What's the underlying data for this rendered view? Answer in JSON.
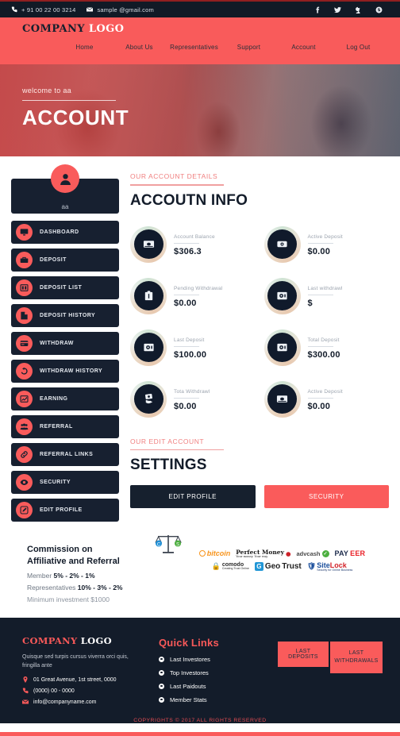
{
  "topbar": {
    "phone": "+ 91 00 22 00 3214",
    "email": "sample @gmail.com",
    "phone_icon": "phone-icon",
    "email_icon": "envelope-icon",
    "social": [
      {
        "name": "facebook-icon",
        "glyph": "f"
      },
      {
        "name": "twitter-icon",
        "glyph": "t"
      },
      {
        "name": "google-plus-icon",
        "glyph": "g"
      },
      {
        "name": "skype-icon",
        "glyph": "s"
      }
    ]
  },
  "nav": {
    "logo_part1": "COMPANY",
    "logo_part2": "LOGO",
    "items": [
      {
        "label": "Home"
      },
      {
        "label": "About Us"
      },
      {
        "label": "Representatives"
      },
      {
        "label": "Support"
      },
      {
        "label": "Account"
      },
      {
        "label": "Log Out"
      }
    ]
  },
  "hero": {
    "welcome": "welcome to aa",
    "title": "ACCOUNT"
  },
  "sidebar": {
    "username": "aa",
    "avatar_icon": "user-icon",
    "items": [
      {
        "label": "DASHBOARD",
        "icon": "monitor-icon"
      },
      {
        "label": "DEPOSIT",
        "icon": "briefcase-icon"
      },
      {
        "label": "DEPOSIT LIST",
        "icon": "list-icon"
      },
      {
        "label": "DEPOSIT HISTORY",
        "icon": "file-icon"
      },
      {
        "label": "WITHDRAW",
        "icon": "card-icon"
      },
      {
        "label": "WITHDRAW HISTORY",
        "icon": "history-icon"
      },
      {
        "label": "EARNING",
        "icon": "chart-icon"
      },
      {
        "label": "REFERRAL",
        "icon": "users-icon"
      },
      {
        "label": "REFERRAL LINKS",
        "icon": "link-icon"
      },
      {
        "label": "SECURITY",
        "icon": "eye-icon"
      },
      {
        "label": "EDIT PROFILE",
        "icon": "pencil-icon"
      }
    ]
  },
  "account": {
    "kicker": "OUR ACCOUNT DETAILS",
    "title": "ACCOUTN INFO",
    "stats": [
      {
        "label": "Account Balance",
        "value": "$306.3",
        "icon": "banknote-icon"
      },
      {
        "label": "Active Deposit",
        "value": "$0.00",
        "icon": "coin-icon"
      },
      {
        "label": "Pending Withdrawal",
        "value": "$0.00",
        "icon": "briefcase-icon"
      },
      {
        "label": "Last withdrawl",
        "value": "$",
        "icon": "safe-icon"
      },
      {
        "label": "Last Deposit",
        "value": "$100.00",
        "icon": "safe-icon"
      },
      {
        "label": "Total Deposit",
        "value": "$300.00",
        "icon": "safe-icon"
      },
      {
        "label": "Tota Withdrawl",
        "value": "$0.00",
        "icon": "hand-money-icon"
      },
      {
        "label": "Active Deposit",
        "value": "$0.00",
        "icon": "banknote-icon"
      }
    ]
  },
  "settings": {
    "kicker": "OUR EDIT ACCOUNT",
    "title": "SETTINGS",
    "edit_profile_label": "EDIT PROFILE",
    "security_label": "SECURITY"
  },
  "commission": {
    "title_line1": "Commission on",
    "title_line2": "Affiliative and Referral",
    "member_label": "Member ",
    "member_value": "5% - 2% - 1%",
    "rep_label": "Representatives ",
    "rep_value": "10% - 3% - 2%",
    "minimum": "Minimum investment $1000",
    "scale_icon": "balance-scale-icon",
    "partner_logos_row1": [
      "bitcoin",
      "Perfect Money",
      "advcash",
      "PAYEER"
    ],
    "partner_logos_row2": [
      "COMODO",
      "GeoTrust",
      "SiteLock"
    ],
    "bitcoin_text": "bitcoin",
    "perfectmoney_text": "Perfect Money",
    "perfectmoney_sub": "Your money. Your way.",
    "advcash_text": "advcash",
    "payeer_part1": "PAY",
    "payeer_part2": "EER",
    "comodo_text": "comodo",
    "comodo_sub": "Creating Trust Online",
    "geotrust_part1": "Geo",
    "geotrust_part2": "Trust",
    "sitelock_part1": "Site",
    "sitelock_part2": "Lock",
    "sitelock_sub": "Security for Online Business"
  },
  "footer": {
    "logo_part1": "COMPANY",
    "logo_part2": "LOGO",
    "description": "Quisque sed turpis cursus viverra orci quis, fringilla ante",
    "address": "01 Great Avenue, 1st street, 0000",
    "phone": "(0000) 00 - 0000",
    "email": "info@companyname.com",
    "address_icon": "map-marker-icon",
    "phone_icon": "phone-icon",
    "email_icon": "envelope-icon",
    "quick_links_title": "Quick Links",
    "quick_links": [
      {
        "label": "Last Investores"
      },
      {
        "label": "Top Investores"
      },
      {
        "label": "Last Paidouts"
      },
      {
        "label": "Member Stats"
      }
    ],
    "last_deposits_label": "LAST DEPOSITS",
    "last_withdrawals_label": "LAST WITHDRAWALS",
    "copyright": "COPYRIGHTS © 2017 ALL RIGHTS RESERVED"
  },
  "colors": {
    "accent_red": "#fa5b5b",
    "dark_navy": "#131c2a",
    "panel_navy": "#172030",
    "footer_red": "#e04b52"
  }
}
